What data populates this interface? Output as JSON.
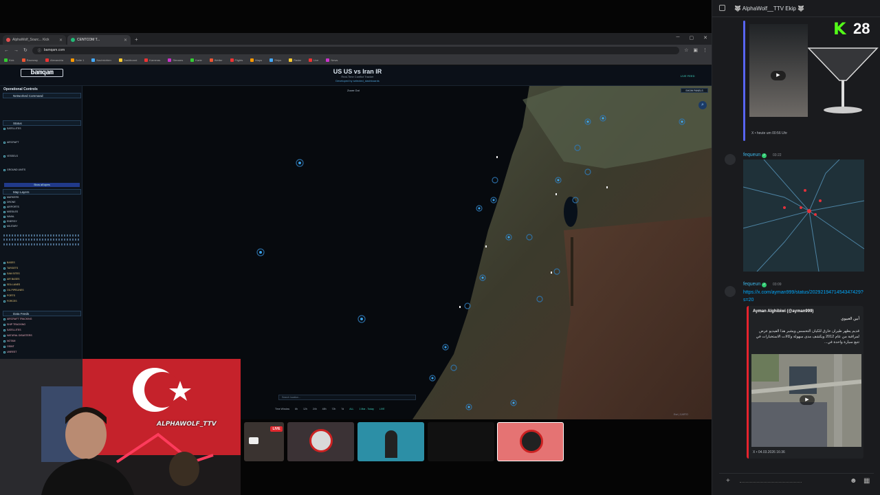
{
  "browser": {
    "tabs": [
      {
        "label": "AlphaWolf_Sourc... Kick"
      },
      {
        "label": "CENTCOM T..."
      }
    ],
    "url": "bamqam.com",
    "bookmarks": [
      "Kick",
      "Raceway",
      "Alexandria",
      "Seite 1",
      "Nachrichten",
      "Dashboard",
      "Kameras",
      "Streams",
      "Karte",
      "Wetter",
      "Flights",
      "Maps",
      "Ships",
      "Radar",
      "Live",
      "News"
    ]
  },
  "site": {
    "logo": "bamqam",
    "title": "US US vs Iran IR",
    "subtitle": "Real-Time Conflict Tracker",
    "credit": "Developed by selected_dashboards",
    "right_button": "LIVE FEED",
    "zoom_out": "Zoom Out",
    "map_button": "SHOW PANELS",
    "search_placeholder": "Search location...",
    "timeline": {
      "label": "Time Window",
      "options": [
        "6h",
        "12h",
        "24h",
        "48h",
        "72h",
        "7d",
        "ALL"
      ],
      "active_option": "ALL",
      "range": "1 Mar - Today",
      "live": "LIVE"
    },
    "attribution": "Esri | CARTO"
  },
  "panel": {
    "header": "Operational Controls",
    "network": "Networked Command",
    "status_title": "Status",
    "status_items": [
      "SATELLITES",
      "AIRCRAFT",
      "VESSELS",
      "GROUND UNITS"
    ],
    "show_all": "Show all layers",
    "map_layers": "Map Layers",
    "layer_items": [
      "MARKERS",
      "DRONE",
      "AIRPORTS",
      "MISSILES",
      "NAVAL",
      "ENERGY",
      "MILITARY"
    ],
    "base_items": [
      "BASES",
      "TARGETS",
      "SAM SITES",
      "AIR BASES",
      "SEA LANES",
      "OIL PIPELINES",
      "PORTS",
      "FORCES"
    ],
    "data_feeds": "Data Feeds",
    "feed_items": [
      "AIRCRAFT TRACKING",
      "SHIP TRACKING",
      "SATELLITES",
      "NATURAL DISASTERS",
      "NOTAM",
      "OSINT",
      "UNREST"
    ]
  },
  "stream": {
    "overlay_name": "ALPHAWOLF_TTV",
    "live_badge": "LIVE"
  },
  "chat": {
    "title": "🐺 AlphaWolf__TTV Ekip 🐺",
    "kick_count": "28",
    "messages": [
      {
        "footer": "X • heute um 00:56 Uhr"
      },
      {
        "user": "fequeun",
        "time": "03:22"
      },
      {
        "user": "fequeun",
        "time": "03:09",
        "link": "https://x.com/ayman999/status/2029219471454347429?s=20",
        "embed_author": "Ayman Alghibiwi (@ayman999)",
        "embed_title": "أبين الغبيوي",
        "embed_desc": "قديم يظهر طيران خارق للكيان التحسس ويشير هذا الفيديو عرض لمراقبة من عام 2012 ويكشف مدى سهولة وكالات الاستخبارات في تتبع سيارة واحدة في...",
        "footer": "X • 04.03.2026 16:36"
      }
    ]
  }
}
